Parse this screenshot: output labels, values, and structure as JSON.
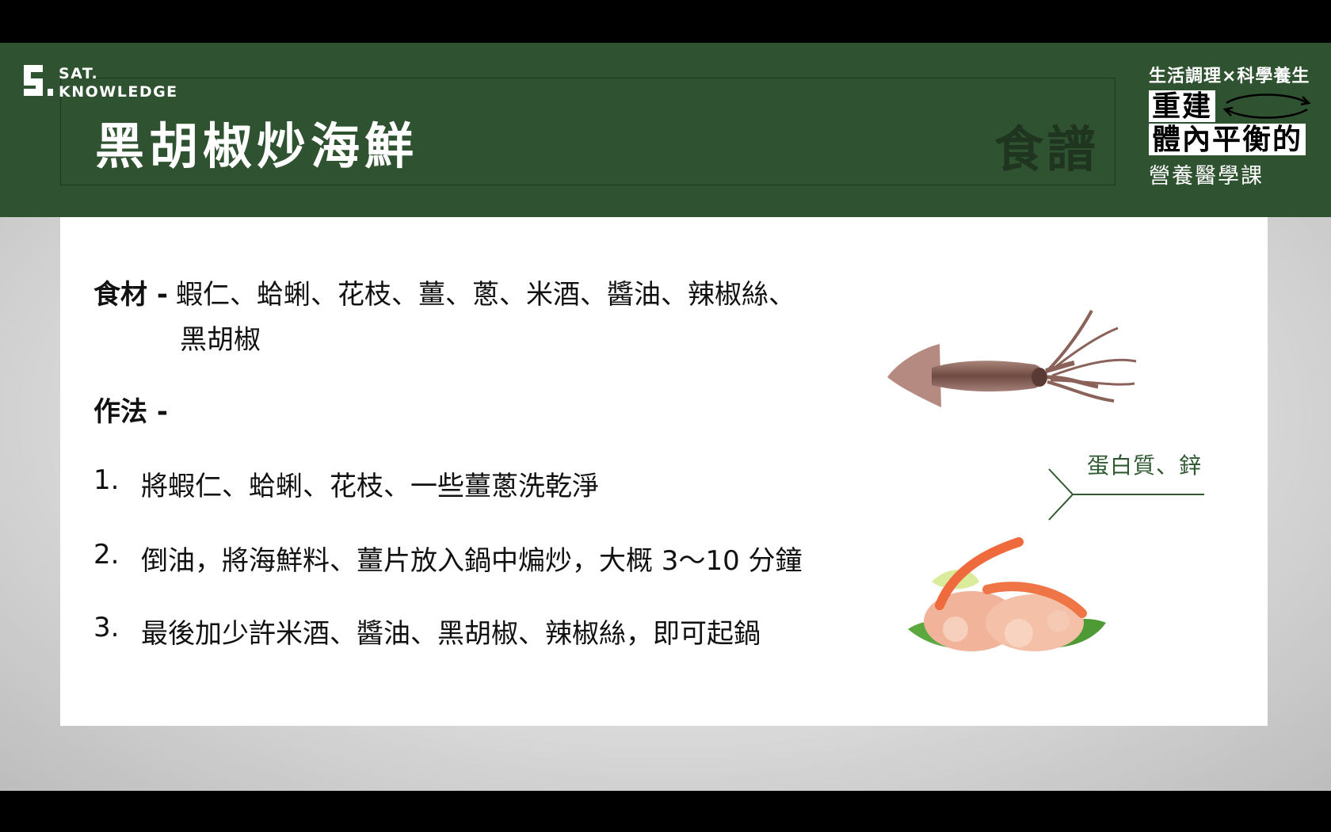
{
  "brand": {
    "line1": "SAT.",
    "line2": "KNOWLEDGE"
  },
  "slide": {
    "title": "黑胡椒炒海鮮",
    "section": "食譜"
  },
  "course": {
    "subtitle": "生活調理×科學養生",
    "line1": "重建",
    "line2": "體內平衡的",
    "line3": "營養醫學課"
  },
  "ingredients": {
    "label": "食材 -",
    "line1": "蝦仁、蛤蜊、花枝、薑、蔥、米酒、醬油、辣椒絲、",
    "line2": "黑胡椒"
  },
  "method": {
    "label": "作法 -",
    "steps": [
      {
        "num": "1.",
        "text": "將蝦仁、蛤蜊、花枝、一些薑蔥洗乾淨"
      },
      {
        "num": "2.",
        "text": "倒油，將海鮮料、薑片放入鍋中煸炒，大概 3～10 分鐘"
      },
      {
        "num": "3.",
        "text": "最後加少許米酒、醬油、黑胡椒、辣椒絲，即可起鍋"
      }
    ]
  },
  "nutrition_note": "蛋白質、鋅",
  "icons": {
    "squid": "squid-photo",
    "shrimp": "shrimp-photo",
    "arrows": "double-arrow-icon"
  },
  "colors": {
    "header_green": "#2f5230",
    "accent_green": "#2f5a31"
  }
}
